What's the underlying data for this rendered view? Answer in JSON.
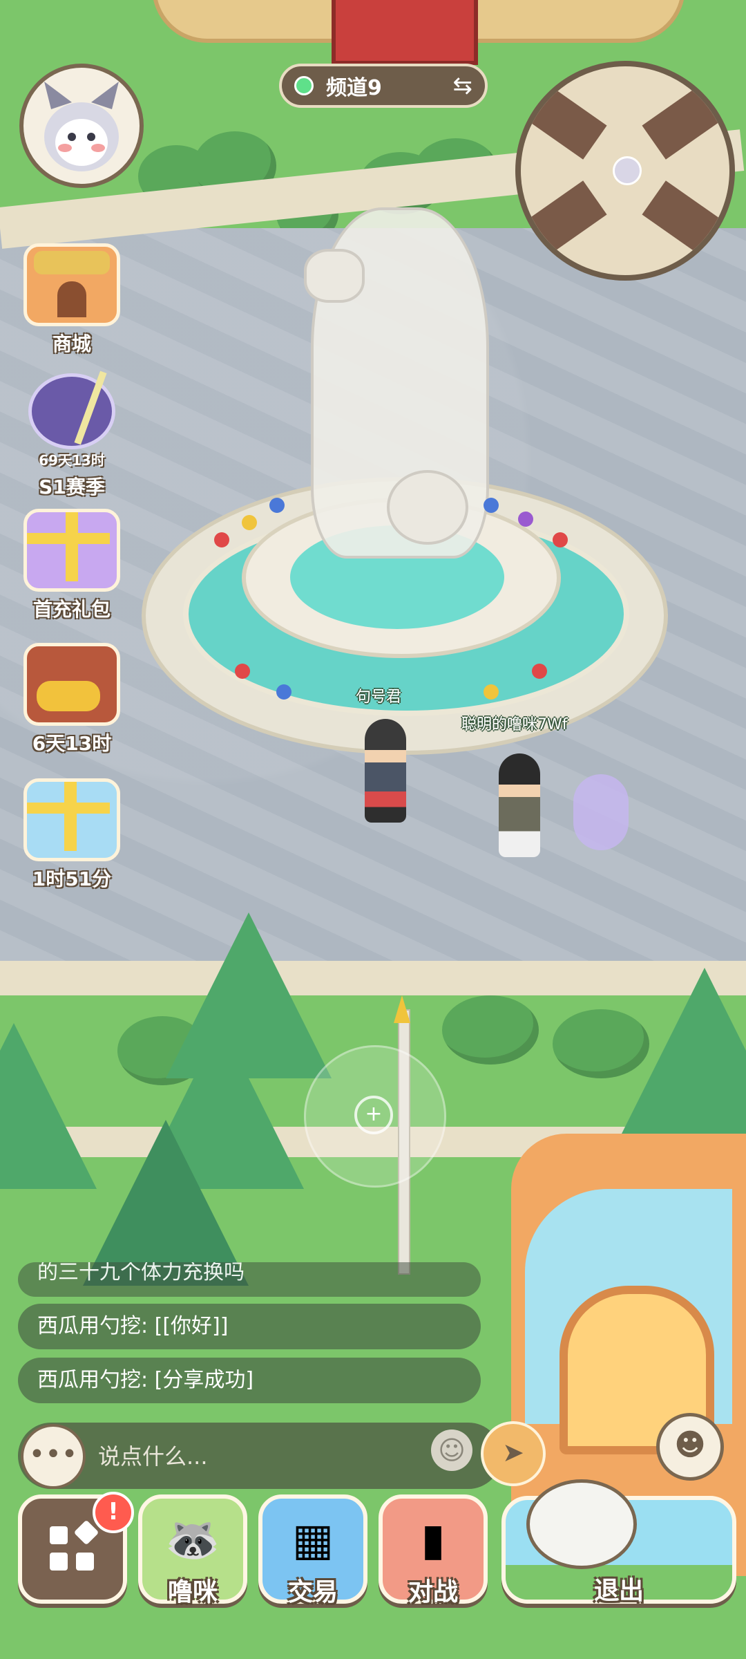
{
  "channel": {
    "label": "频道9",
    "status_color": "#5fe08a",
    "swap_icon": "swap-icon"
  },
  "sidebar": [
    {
      "id": "shop",
      "label": "商城",
      "sub": "",
      "icon": "shop-icon"
    },
    {
      "id": "season",
      "label": "S1赛季",
      "sub": "69天13时",
      "icon": "season-icon"
    },
    {
      "id": "first-recharge",
      "label": "首充礼包",
      "sub": "",
      "icon": "gift-icon"
    },
    {
      "id": "treasure",
      "label": "6天13时",
      "sub": "",
      "icon": "treasure-chest-icon"
    },
    {
      "id": "timed-gift",
      "label": "1时51分",
      "sub": "",
      "icon": "gift-box-icon"
    }
  ],
  "world": {
    "player_name": "句号君",
    "other_player_name": "聪明的噜咪7Wf"
  },
  "chat": {
    "lines": [
      "的三十九个体力充换吗",
      "西瓜用勺挖: [[你好]]",
      "西瓜用勺挖: [分享成功]"
    ],
    "placeholder": "说点什么..."
  },
  "dock": {
    "menu_badge": "!",
    "pet_label": "噜咪",
    "trade_label": "交易",
    "battle_label": "对战",
    "exit_label": "退出"
  },
  "colors": {
    "accent": "#6e5d4a",
    "grass": "#7cc66a",
    "water": "#66d3c8",
    "badge": "#ff5b4f"
  }
}
